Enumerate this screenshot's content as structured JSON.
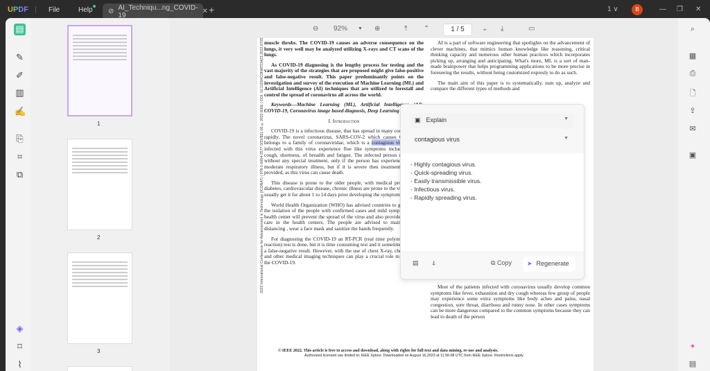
{
  "app": {
    "logo": "UPDF",
    "menu": [
      "File",
      "Help"
    ],
    "tab_title": "AI_Techniqu...ng_COVID-19",
    "account_count": "1 ∨",
    "avatar_letter": "B"
  },
  "toolbar": {
    "zoom": "92%",
    "page": "1 / 5"
  },
  "thumbnails": [
    {
      "num": "1"
    },
    {
      "num": "2"
    },
    {
      "num": "3"
    }
  ],
  "page": {
    "sidebar_text": "2022 International Conference for Advancement in Technology (ICONAT) | 978-1-6654-2577-3/22/$31.00 ©2022 IEEE | DOI: 10.1109/ICONAT53423.2022.9725",
    "left": {
      "abs1": "muscle throbs. The COVID-19 causes an adverse consequence on the lungs, it very well may be analyzed utilizing X-rays and CT scans of the lungs.",
      "abs2": "As COVID-19 diagnosing is the lengthy process for testing and the vast majority of the strategies that are proposed might give false-positive and false-negative result. This paper predominantly points on the investigation and survey of the execution of Machine Learning (ML) and Artificial Intelligence (AI) techniques that are utilized to forestall and control the spread of coronavirus all across the world.",
      "keywords": "Keywords—Machine Learning (ML), Artificial Intelligence (AI), COVID-19, Coronavirus image based diagnosis, Deep Learning (DL)",
      "heading": "I. Introduction",
      "p1a": "COVID-19 is a infectious disease, that has spread in many countries very rapidly. The novel coronavirus, SARS-COV-2 which causes COVID-19, belongs to a family of coronaviridae, which is a ",
      "p1hl": "contagious virus",
      "p1b": ". People infected with this virus experience flue like symptoms including, fever, cough, shortness, of breadth and fatigue. The infected person can recover without any special treatment, only if the person has experienced mild to moderate respiratory illness, but if it is severe then treatment has to be provided, as this virus can cause death.",
      "p2": "This disease is prone to the older people, with medical problems like diabetes, cardiovascular disease, chronic illness are prone to the virus. People usually get it for about 1 to 14 days prior developing the symptoms.",
      "p3": "World Health Organization (WHO) has advised countries to get tested as the isolation of the people with confirmed cases and mild symptoms in the health center will prevent the spread of the virus and also provide acceptable care in the health centers. The people are advised to maintain social distancing , wear a face mask and sanitize the hands frequently.",
      "p4": "For diagnosing the COVID-19 an RT-PCR (real time polymerase chain reaction) test is done, but it is time consuming test and it sometimes produces a false-negative result. However, with the use of chest X-ray, chest CT-scan and other medical imaging techniques can play a crucial role in diagnosing the COVID-19."
    },
    "right": {
      "p1": "AI is a part of software engineering that spotlights on the advancement of clever machines, that mimics human knowledge like reasoning, critical thinking capacity and numerous other human practices which incorporates picking up, arranging and anticipating. What's more, ML is a sort of man-made brainpower that helps programming applications to be more precise in foreseeing the results, without being customized expresly to do as such.",
      "p2": "The main aim of this paper is to systematically, sum up, analyze and compare the different types of methods and",
      "p3": "Most of the patients infected with coronavirus usually develop common symptoms like fever, exhaustion and dry cough whereas few group of people may experience some extra symptoms like body aches and pains, nasal congestion, sore throat, diarrhoea and runny nose. In other cases symptoms can be more dangerous compared to the common symptoms because they can lead to death of the person"
    },
    "footer1": "© IEEE 2022. This article is free to access and download, along with rights for full text and data mining, re-use and analysis.",
    "footer2": "Authorized licensed use limited to: IEEE Xplore. Downloaded on August 16,2023 at 11:56:08 UTC from IEEE Xplore. Restrictions apply."
  },
  "ai_popup": {
    "mode": "Explain",
    "query": "contagious virus",
    "answer": [
      "- Highly contagious virus.",
      "- Quick-spreading virus.",
      "- Easily transmissible virus.",
      "- Infectious virus.",
      "- Rapidly spreading virus."
    ],
    "copy_label": "Copy",
    "regenerate_label": "Regenerate",
    "accent": "#8b5cf6"
  }
}
